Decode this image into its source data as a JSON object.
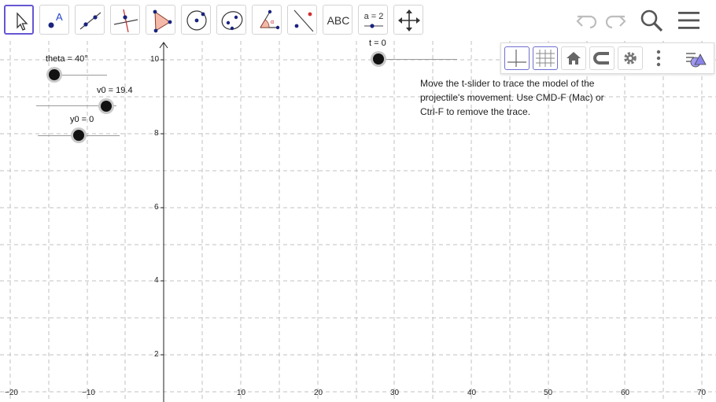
{
  "toolbar": {
    "tools": [
      {
        "name": "move",
        "icon": "pointer-arrow-icon"
      },
      {
        "name": "point",
        "icon": "point-icon",
        "label": "A"
      },
      {
        "name": "line",
        "icon": "line-icon"
      },
      {
        "name": "perpendicular",
        "icon": "perpendicular-line-icon"
      },
      {
        "name": "polygon",
        "icon": "polygon-icon"
      },
      {
        "name": "circle",
        "icon": "circle-center-point-icon"
      },
      {
        "name": "ellipse",
        "icon": "ellipse-icon"
      },
      {
        "name": "angle",
        "icon": "angle-icon"
      },
      {
        "name": "reflect",
        "icon": "reflect-about-line-icon"
      },
      {
        "name": "text",
        "icon": "text-icon",
        "label": "ABC"
      },
      {
        "name": "slider",
        "icon": "slider-icon",
        "label": "a = 2"
      },
      {
        "name": "move-graphics",
        "icon": "move-graphics-view-icon"
      }
    ],
    "right": [
      "undo-icon",
      "redo-icon",
      "search-icon",
      "menu-icon"
    ]
  },
  "stylebar": {
    "buttons": [
      "axes-icon",
      "grid-icon",
      "home-icon",
      "snap-magnet-icon",
      "settings-gear-icon",
      "more-vertical-icon",
      "toggle-stylebar-icon"
    ]
  },
  "axes": {
    "x_ticks": [
      "−20",
      "−10",
      "10",
      "20",
      "30",
      "40",
      "50",
      "60",
      "70"
    ],
    "y_ticks": [
      "10",
      "8",
      "6",
      "4",
      "2"
    ]
  },
  "sliders": {
    "theta": {
      "label": "theta = 40°"
    },
    "v0": {
      "label": "v0 = 19.4"
    },
    "y0": {
      "label": "y0 = 0"
    },
    "t": {
      "label": "t = 0"
    }
  },
  "info": {
    "text": "Move the t-slider to trace the model of the projectile's movement. Use CMD-F (Mac) or Ctrl-F to remove the trace."
  },
  "colors": {
    "accent": "#6557d2",
    "grid": "#c0c0c0",
    "point": "#1a237e"
  }
}
